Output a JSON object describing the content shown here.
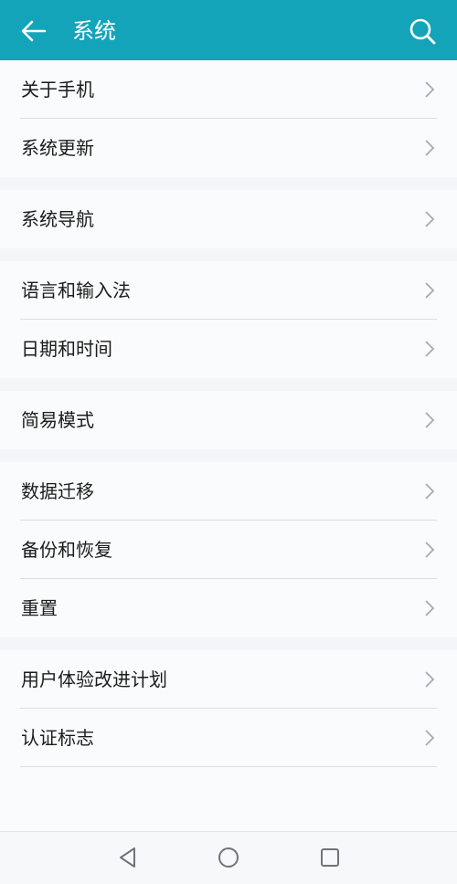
{
  "header": {
    "title": "系统"
  },
  "groups": [
    {
      "items": [
        {
          "label": "关于手机"
        },
        {
          "label": "系统更新"
        }
      ]
    },
    {
      "items": [
        {
          "label": "系统导航"
        }
      ]
    },
    {
      "items": [
        {
          "label": "语言和输入法"
        },
        {
          "label": "日期和时间"
        }
      ]
    },
    {
      "items": [
        {
          "label": "简易模式"
        }
      ]
    },
    {
      "items": [
        {
          "label": "数据迁移"
        },
        {
          "label": "备份和恢复"
        },
        {
          "label": "重置"
        }
      ]
    },
    {
      "items": [
        {
          "label": "用户体验改进计划"
        },
        {
          "label": "认证标志"
        }
      ]
    }
  ],
  "icons": {
    "back": "back-arrow-icon",
    "search": "search-icon",
    "chevron": "chevron-right-icon",
    "nav_back": "triangle-back-icon",
    "nav_home": "circle-home-icon",
    "nav_recent": "square-recent-icon"
  },
  "colors": {
    "accent": "#14a4ba",
    "background": "#f3f6f8",
    "card": "#f9fbfc"
  }
}
